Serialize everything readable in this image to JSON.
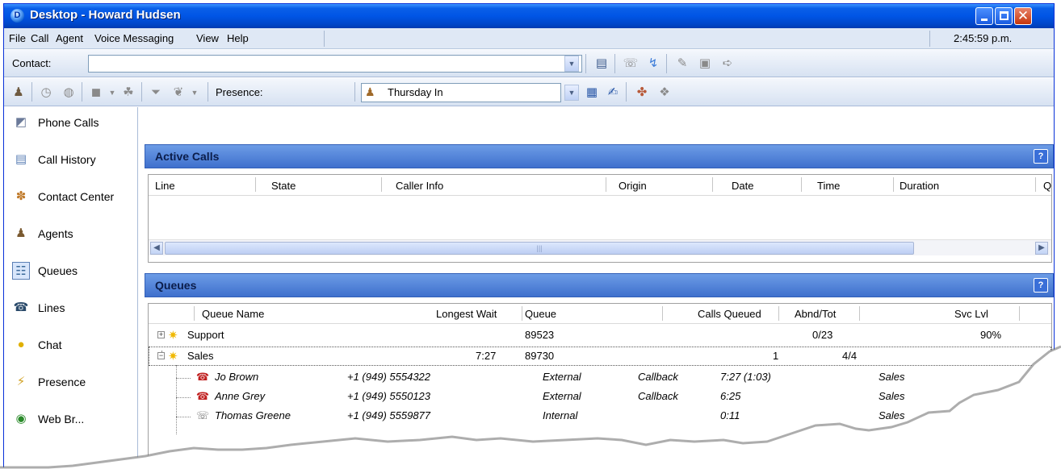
{
  "window": {
    "title": "Desktop - Howard Hudsen",
    "logo_letter": "D"
  },
  "menu": {
    "items": [
      "File",
      "Call",
      "Agent",
      "Voice Messaging",
      "View",
      "Help"
    ],
    "clock": "2:45:59 p.m."
  },
  "toolbar1": {
    "contact_label": "Contact:",
    "contact_value": ""
  },
  "toolbar2": {
    "presence_label": "Presence:",
    "presence_value": "Thursday In"
  },
  "sidebar": {
    "items": [
      {
        "label": "Phone Calls",
        "icon": "phone-calls-icon"
      },
      {
        "label": "Call History",
        "icon": "call-history-icon"
      },
      {
        "label": "Contact Center",
        "icon": "contact-center-icon"
      },
      {
        "label": "Agents",
        "icon": "agents-icon"
      },
      {
        "label": "Queues",
        "icon": "queues-icon",
        "active": true
      },
      {
        "label": "Lines",
        "icon": "lines-icon"
      },
      {
        "label": "Chat",
        "icon": "chat-icon"
      },
      {
        "label": "Presence",
        "icon": "presence-icon"
      },
      {
        "label": "Web Br...",
        "icon": "web-browser-icon"
      }
    ]
  },
  "active_calls": {
    "title": "Active Calls",
    "help": "?",
    "columns": [
      "Line",
      "State",
      "Caller Info",
      "Origin",
      "Date",
      "Time",
      "Duration",
      "Q"
    ],
    "scroll_grip": "|||"
  },
  "queues": {
    "title": "Queues",
    "help": "?",
    "columns": [
      "Queue Name",
      "Longest Wait",
      "Queue",
      "Calls Queued",
      "Abnd/Tot",
      "Svc Lvl"
    ],
    "rows": [
      {
        "name": "Support",
        "longest_wait": "",
        "queue": "89523",
        "calls_queued": "",
        "abnd_tot": "0/23",
        "svc_lvl": "90%",
        "expanded": false
      },
      {
        "name": "Sales",
        "longest_wait": "7:27",
        "queue": "89730",
        "calls_queued": "1",
        "abnd_tot": "4/4",
        "svc_lvl": "",
        "expanded": true
      }
    ],
    "calls": [
      {
        "name": "Jo Brown",
        "number": "+1 (949) 5554322",
        "origin": "External",
        "type": "Callback",
        "time": "7:27  (1:03)",
        "queue": "Sales"
      },
      {
        "name": "Anne Grey",
        "number": "+1 (949) 5550123",
        "origin": "External",
        "type": "Callback",
        "time": "6:25",
        "queue": "Sales"
      },
      {
        "name": "Thomas Greene",
        "number": "+1 (949) 5559877",
        "origin": "Internal",
        "type": "",
        "time": "0:11",
        "queue": "Sales"
      }
    ]
  },
  "colors": {
    "titlebar": "#0055e5",
    "panel_header": "#4f80d8",
    "menubar": "#dfe8f5"
  }
}
